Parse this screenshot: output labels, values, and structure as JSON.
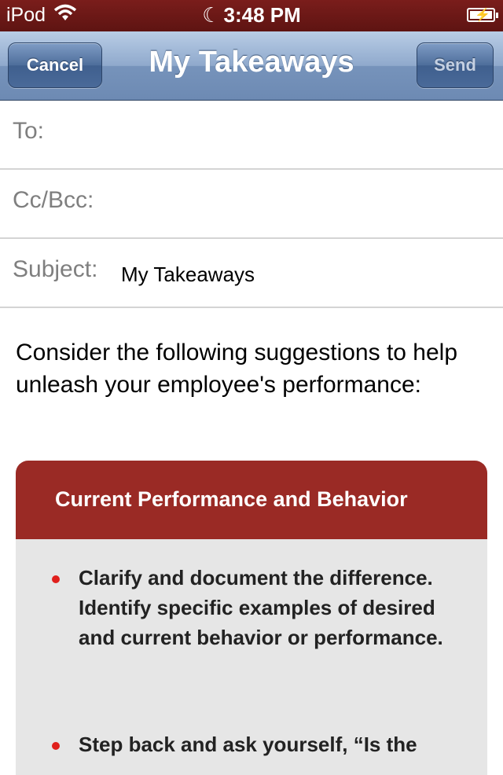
{
  "status_bar": {
    "carrier": "iPod",
    "time": "3:48 PM"
  },
  "nav": {
    "title": "My Takeaways",
    "cancel_label": "Cancel",
    "send_label": "Send"
  },
  "fields": {
    "to_label": "To:",
    "to_value": "",
    "cc_label": "Cc/Bcc:",
    "cc_value": "",
    "subject_label": "Subject:",
    "subject_value": "My Takeaways"
  },
  "body": {
    "intro": "Consider the following suggestions to help unleash your employee's performance:",
    "section": {
      "heading": "Current Performance and Behavior",
      "bullets": [
        "Clarify and document the difference.  Identify specific examples of desired and current behavior or performance.",
        "Step back and ask yourself, “Is the"
      ]
    }
  },
  "colors": {
    "status_bar": "#6a1816",
    "nav_bar": "#7b97bd",
    "section_header": "#9a2a25",
    "bullet": "#e0201c"
  }
}
